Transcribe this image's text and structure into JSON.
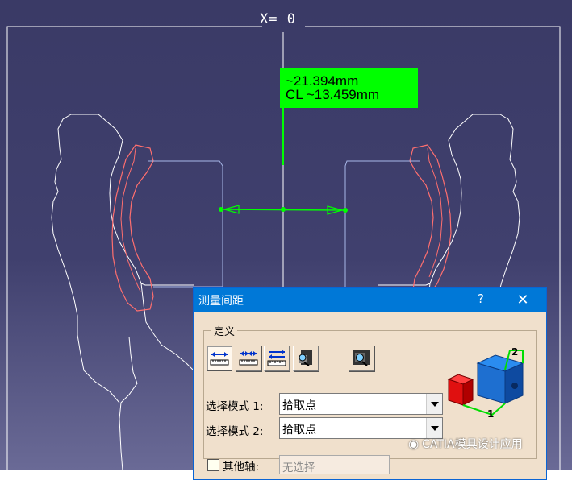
{
  "viewport": {
    "x_label": "X=   0",
    "measure": {
      "line1": "~21.394mm",
      "line2": "CL ~13.459mm"
    },
    "colors": {
      "background": "#3a3a66",
      "profile_white": "#ffffff",
      "profile_red": "#ff6b6b",
      "profile_blue": "#aabbee",
      "measure_green": "#00ff00"
    }
  },
  "dialog": {
    "title": "测量间距",
    "help": "?",
    "close": "✕",
    "group_label": "定义",
    "tools": [
      {
        "name": "measure-between-tool",
        "active": true
      },
      {
        "name": "measure-in-chain-tool",
        "active": false
      },
      {
        "name": "measure-in-fan-tool",
        "active": false
      },
      {
        "name": "measure-item-tool",
        "active": false
      },
      {
        "name": "measure-thickness-tool",
        "active": false
      }
    ],
    "mode1_label": "选择模式 1:",
    "mode1_value": "拾取点",
    "mode2_label": "选择模式 2:",
    "mode2_value": "拾取点",
    "other_axis_label": "其他轴:",
    "other_axis_value": "无选择",
    "preview_labels": {
      "one": "1",
      "two": "2"
    }
  },
  "watermark": {
    "icon": "wechat-icon",
    "text": "CATIA模具设计应用"
  }
}
